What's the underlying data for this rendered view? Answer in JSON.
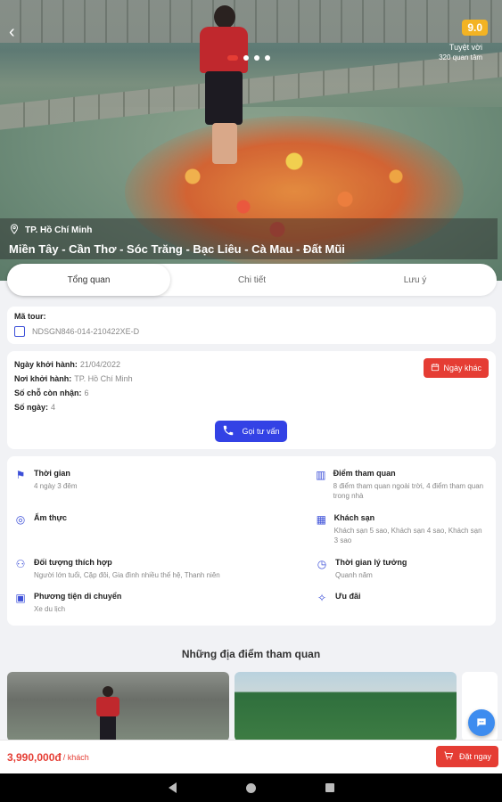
{
  "hero": {
    "rating": "9.0",
    "rating_label": "Tuyệt vời",
    "rating_count": "320 quan tâm",
    "location": "TP. Hồ Chí Minh",
    "title": "Miền Tây - Cần Thơ - Sóc Trăng - Bạc Liêu - Cà Mau - Đất Mũi"
  },
  "tabs": [
    "Tổng quan",
    "Chi tiết",
    "Lưu ý"
  ],
  "tour": {
    "code_label": "Mã tour:",
    "code": "NDSGN846-014-210422XE-D"
  },
  "departure": {
    "date_label": "Ngày khởi hành:",
    "date": "21/04/2022",
    "place_label": "Nơi khởi hành:",
    "place": "TP. Hồ Chí Minh",
    "seats_label": "Số chỗ còn nhận:",
    "seats": "6",
    "days_label": "Số ngày:",
    "days": "4",
    "other_date_btn": "Ngày khác",
    "call_btn": "Gọi tư vấn"
  },
  "info": {
    "time_label": "Thời gian",
    "time_value": "4 ngày 3 đêm",
    "sights_label": "Điểm tham quan",
    "sights_value": "8 điểm tham quan ngoài trời, 4 điểm tham quan trong nhà",
    "food_label": "Ẩm thực",
    "hotel_label": "Khách sạn",
    "hotel_value": "Khách sạn 5 sao, Khách sạn 4 sao, Khách sạn 3 sao",
    "audience_label": "Đối tượng thích hợp",
    "audience_value": "Người lớn tuổi, Cặp đôi, Gia đình nhiều thế hệ, Thanh niên",
    "ideal_label": "Thời gian lý tưởng",
    "ideal_value": "Quanh năm",
    "transport_label": "Phương tiện di chuyển",
    "transport_value": "Xe du lịch",
    "promo_label": "Ưu đãi"
  },
  "places_title": "Những địa điểm tham quan",
  "booking": {
    "price": "3,990,000đ",
    "per": "/ khách",
    "book_btn": "Đặt ngay"
  },
  "colors": {
    "accent": "#3342e5",
    "danger": "#e53d34",
    "star": "#f3b323"
  }
}
